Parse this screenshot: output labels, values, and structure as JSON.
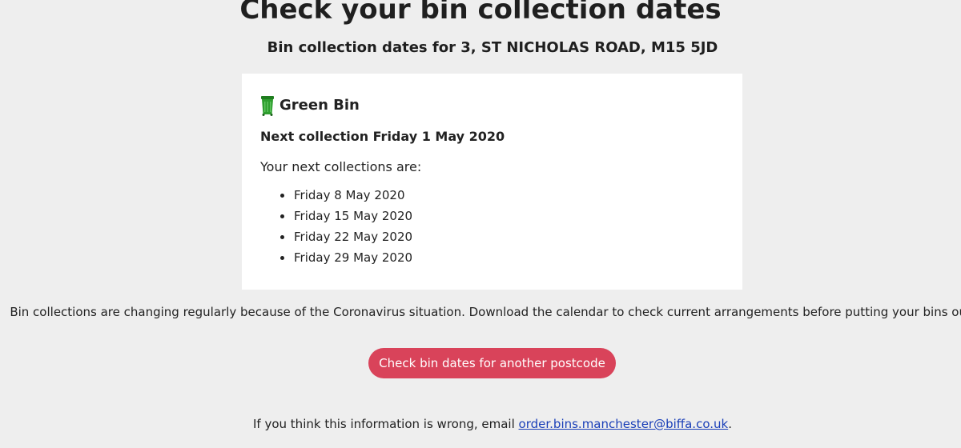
{
  "page": {
    "title": "Check your bin collection dates",
    "address_heading": "Bin collection dates for 3, ST NICHOLAS ROAD, M15 5JD"
  },
  "bin_card": {
    "bin_name": "Green Bin",
    "bin_icon": "wheelie-bin-icon",
    "bin_color": "#2e9e2e",
    "next_collection": "Next collection Friday 1 May 2020",
    "next_collections_label": "Your next collections are:",
    "dates": [
      "Friday 8 May 2020",
      "Friday 15 May 2020",
      "Friday 22 May 2020",
      "Friday 29 May 2020"
    ]
  },
  "notice": "Bin collections are changing regularly because of the Coronavirus situation. Download the calendar to check current arrangements before putting your bins out.",
  "actions": {
    "another_postcode_label": "Check bin dates for another postcode",
    "button_color": "#d9435a"
  },
  "footer": {
    "prefix": "If you think this information is wrong, email ",
    "email": "order.bins.manchester@biffa.co.uk",
    "suffix": "."
  }
}
